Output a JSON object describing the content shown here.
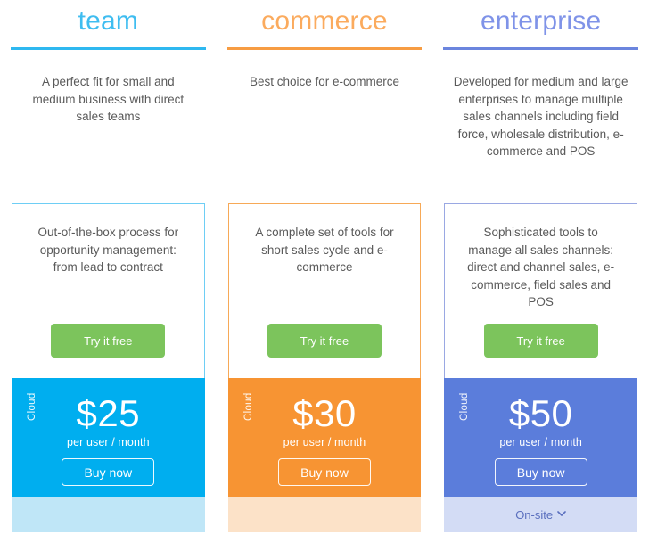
{
  "plans": [
    {
      "id": "team",
      "title": "team",
      "tagline": "A perfect fit for small and medium business with direct sales teams",
      "card_description": "Out-of-the-box process for opportunity management: from lead to contract",
      "try_label": "Try it free",
      "deployment_label": "Cloud",
      "price": "$25",
      "period": "per user / month",
      "buy_label": "Buy now",
      "footer_label": "",
      "accent_color": "#3fbdf0",
      "rule_color": "#2eb8f0",
      "card_border_color": "#6ecef5",
      "price_bg_color": "#00aeef",
      "footer_bg_color": "#bfe6f7",
      "has_onsite": false
    },
    {
      "id": "commerce",
      "title": "commerce",
      "tagline": "Best choice for e-commerce",
      "card_description": "A complete set of tools for short sales cycle and e-commerce",
      "try_label": "Try it free",
      "deployment_label": "Cloud",
      "price": "$30",
      "period": "per user / month",
      "buy_label": "Buy now",
      "footer_label": "",
      "accent_color": "#fbab5e",
      "rule_color": "#f79c42",
      "card_border_color": "#f7a957",
      "price_bg_color": "#f79433",
      "footer_bg_color": "#fce2c8",
      "has_onsite": false
    },
    {
      "id": "enterprise",
      "title": "enterprise",
      "tagline": "Developed for medium and large enterprises to manage multiple sales channels including field force, wholesale distribution, e-commerce and POS",
      "card_description": "Sophisticated tools to manage all sales channels: direct and channel sales, e-commerce, field sales and POS",
      "try_label": "Try it free",
      "deployment_label": "Cloud",
      "price": "$50",
      "period": "per user / month",
      "buy_label": "Buy now",
      "footer_label": "On-site",
      "accent_color": "#7f93e8",
      "rule_color": "#6b85de",
      "card_border_color": "#9aa8e3",
      "price_bg_color": "#5b7ddb",
      "footer_bg_color": "#d3dcf5",
      "has_onsite": true
    }
  ],
  "shared": {
    "try_button_color": "#7cc45c",
    "try_button_text_color": "#ffffff",
    "body_text_color": "#5a5a5a",
    "onsite_text_color": "#5a6fbe",
    "chevron_icon": "chevron-down-icon"
  }
}
